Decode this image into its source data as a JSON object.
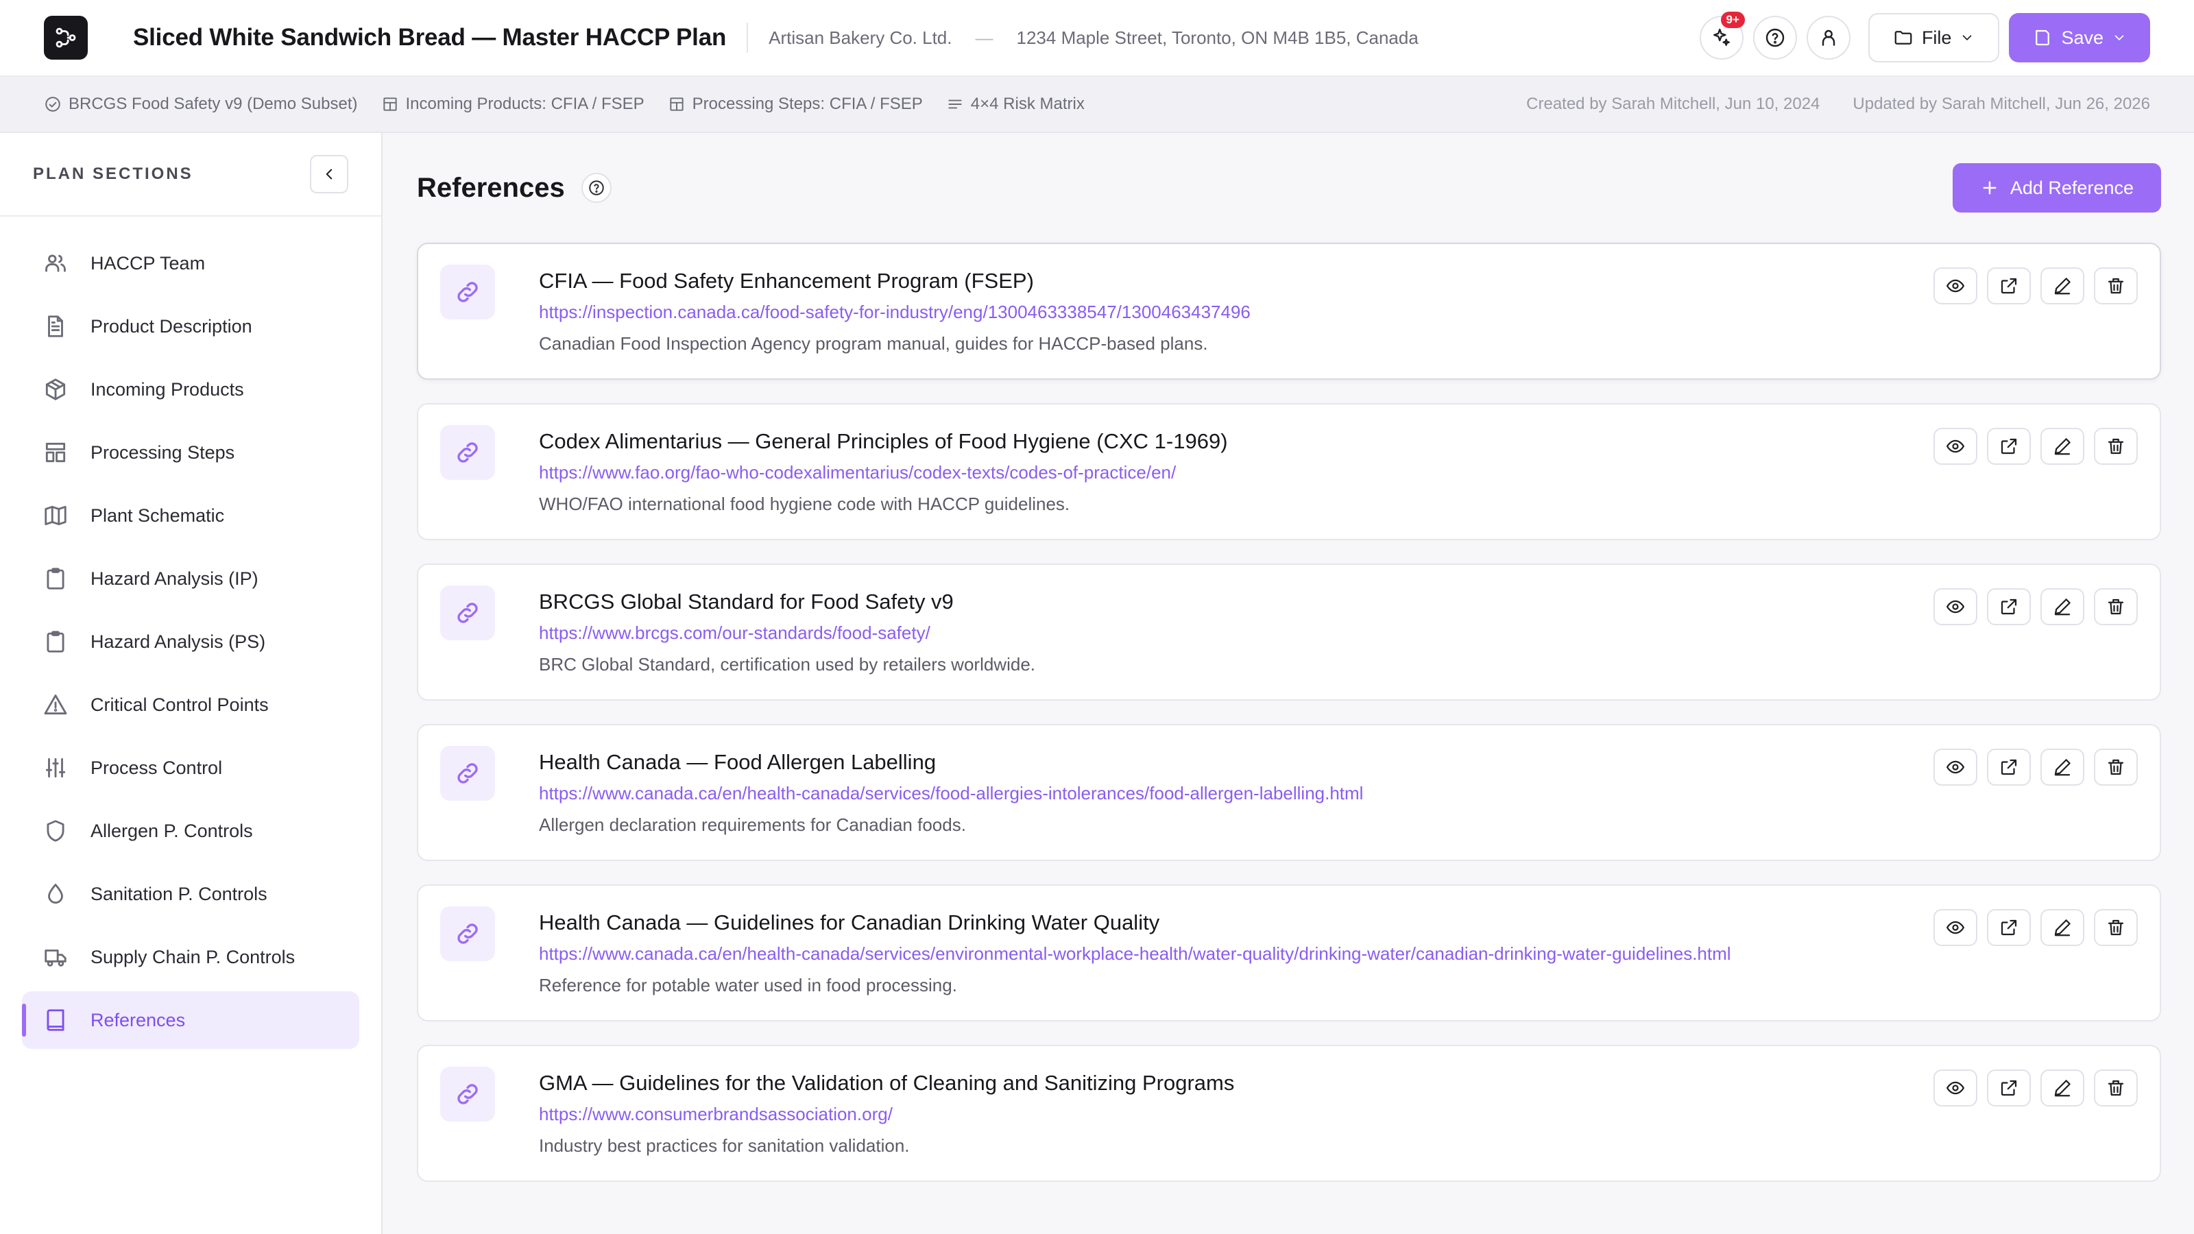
{
  "header": {
    "logo_icon": "workflow-icon",
    "plan_title": "Sliced White Sandwich Bread — Master HACCP Plan",
    "company": "Artisan Bakery Co. Ltd.",
    "separator": "—",
    "address": "1234 Maple Street, Toronto, ON M4B 1B5, Canada",
    "notification_badge": "9+",
    "file_label": "File",
    "save_label": "Save",
    "accent_color": "#9b6cf6"
  },
  "subbar": {
    "items": [
      {
        "icon": "check-circle-icon",
        "label": "BRCGS Food Safety v9 (Demo Subset)"
      },
      {
        "icon": "layout-icon",
        "label": "Incoming Products: CFIA / FSEP"
      },
      {
        "icon": "layout-icon",
        "label": "Processing Steps: CFIA / FSEP"
      },
      {
        "icon": "list-icon",
        "label": "4×4 Risk Matrix"
      }
    ],
    "created": "Created by Sarah Mitchell, Jun 10, 2024",
    "updated": "Updated by Sarah Mitchell, Jun 26, 2026"
  },
  "sidebar": {
    "heading": "PLAN SECTIONS",
    "items": [
      {
        "label": "HACCP Team",
        "icon": "users-icon"
      },
      {
        "label": "Product Description",
        "icon": "document-icon"
      },
      {
        "label": "Incoming Products",
        "icon": "package-icon"
      },
      {
        "label": "Processing Steps",
        "icon": "steps-icon"
      },
      {
        "label": "Plant Schematic",
        "icon": "map-icon"
      },
      {
        "label": "Hazard Analysis (IP)",
        "icon": "clipboard-icon"
      },
      {
        "label": "Hazard Analysis (PS)",
        "icon": "clipboard-icon"
      },
      {
        "label": "Critical Control Points",
        "icon": "warning-icon"
      },
      {
        "label": "Process Control",
        "icon": "sliders-icon"
      },
      {
        "label": "Allergen P. Controls",
        "icon": "shield-icon"
      },
      {
        "label": "Sanitation P. Controls",
        "icon": "droplet-icon"
      },
      {
        "label": "Supply Chain P. Controls",
        "icon": "truck-icon"
      },
      {
        "label": "References",
        "icon": "book-icon"
      }
    ],
    "active_index": 12
  },
  "main": {
    "title": "References",
    "add_button": "Add Reference",
    "references": [
      {
        "title": "CFIA — Food Safety Enhancement Program (FSEP)",
        "url": "https://inspection.canada.ca/food-safety-for-industry/eng/1300463338547/1300463437496",
        "description": "Canadian Food Inspection Agency program manual, guides for HACCP-based plans."
      },
      {
        "title": "Codex Alimentarius — General Principles of Food Hygiene (CXC 1-1969)",
        "url": "https://www.fao.org/fao-who-codexalimentarius/codex-texts/codes-of-practice/en/",
        "description": "WHO/FAO international food hygiene code with HACCP guidelines."
      },
      {
        "title": "BRCGS Global Standard for Food Safety v9",
        "url": "https://www.brcgs.com/our-standards/food-safety/",
        "description": "BRC Global Standard, certification used by retailers worldwide."
      },
      {
        "title": "Health Canada — Food Allergen Labelling",
        "url": "https://www.canada.ca/en/health-canada/services/food-allergies-intolerances/food-allergen-labelling.html",
        "description": "Allergen declaration requirements for Canadian foods."
      },
      {
        "title": "Health Canada — Guidelines for Canadian Drinking Water Quality",
        "url": "https://www.canada.ca/en/health-canada/services/environmental-workplace-health/water-quality/drinking-water/canadian-drinking-water-guidelines.html",
        "description": "Reference for potable water used in food processing."
      },
      {
        "title": "GMA — Guidelines for the Validation of Cleaning and Sanitizing Programs",
        "url": "https://www.consumerbrandsassociation.org/",
        "description": "Industry best practices for sanitation validation."
      }
    ]
  }
}
